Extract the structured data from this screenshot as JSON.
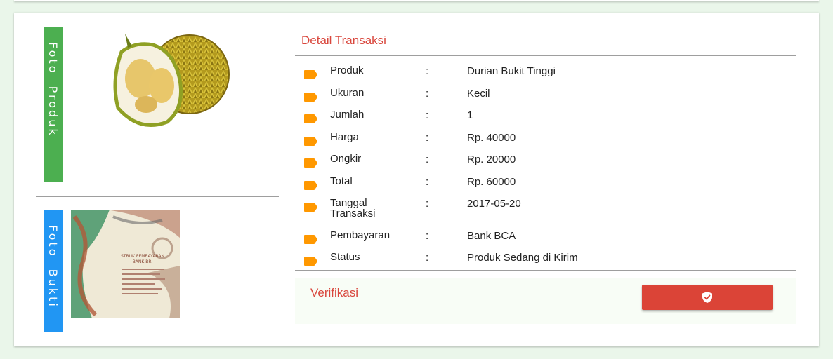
{
  "photo_section": {
    "product_label": "Foto  Produk",
    "proof_label": "Foto  Bukti"
  },
  "receipt_image": {
    "title": "STRUK PEMBAYARAN",
    "subtitle": "BANK BRI"
  },
  "detail": {
    "title": "Detail Transaksi",
    "rows": [
      {
        "label": "Produk",
        "colon": ":",
        "value": "Durian Bukit Tinggi"
      },
      {
        "label": "Ukuran",
        "colon": ":",
        "value": "Kecil"
      },
      {
        "label": "Jumlah",
        "colon": ":",
        "value": "1"
      },
      {
        "label": "Harga",
        "colon": ":",
        "value": "Rp. 40000"
      },
      {
        "label": "Ongkir",
        "colon": ":",
        "value": "Rp. 20000"
      },
      {
        "label": "Total",
        "colon": ":",
        "value": "Rp. 60000"
      },
      {
        "label": "Tanggal Transaksi",
        "colon": ":",
        "value": "2017-05-20"
      },
      {
        "label": "Pembayaran",
        "colon": ":",
        "value": "Bank BCA"
      },
      {
        "label": "Status",
        "colon": ":",
        "value": "Produk Sedang di Kirim"
      }
    ]
  },
  "verification": {
    "label": "Verifikasi",
    "button_icon": "shield-check-icon"
  },
  "colors": {
    "background": "#eaf6ea",
    "accent_red": "#d9473d",
    "button_red": "#db4437",
    "tag_orange": "#ff9800",
    "product_label_green": "#4caf50",
    "proof_label_blue": "#2196f3"
  }
}
